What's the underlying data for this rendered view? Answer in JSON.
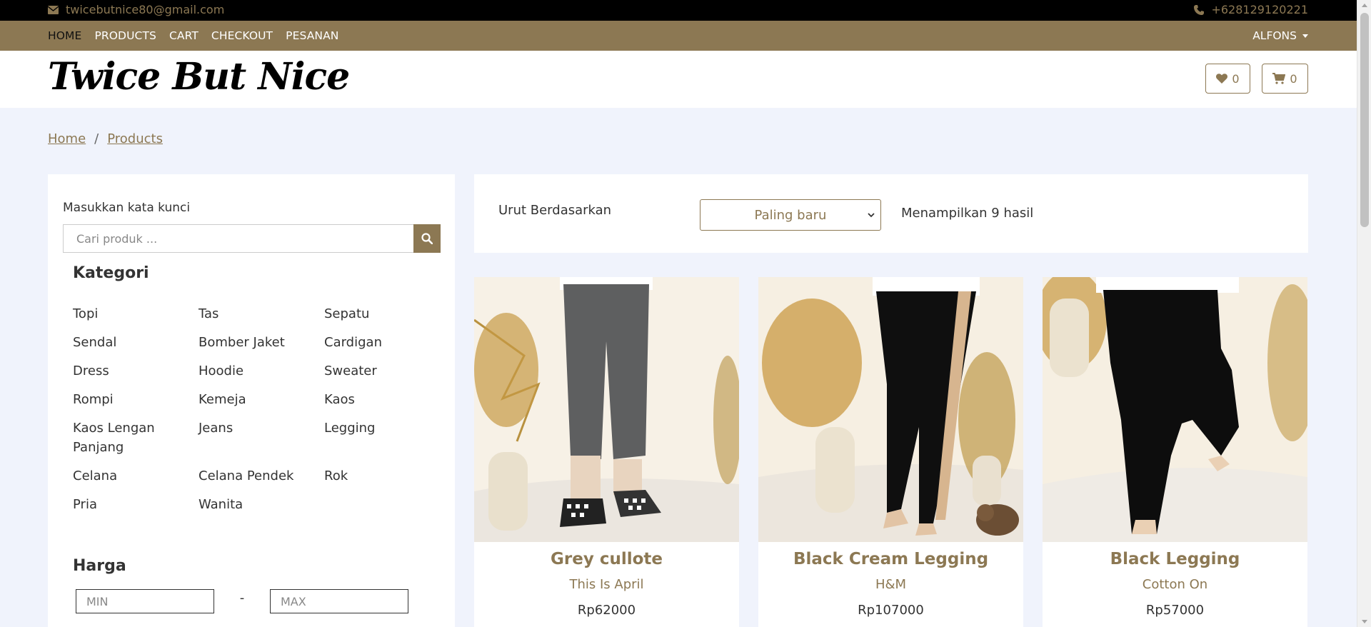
{
  "topbar": {
    "email": "twicebutnice80@gmail.com",
    "phone": "+628129120221",
    "email_icon": "envelope-icon",
    "phone_icon": "phone-icon"
  },
  "nav": {
    "items": [
      "HOME",
      "PRODUCTS",
      "CART",
      "CHECKOUT",
      "PESANAN"
    ],
    "active": "HOME",
    "user": "ALFONS"
  },
  "header": {
    "logo": "Twice But Nice",
    "wishlist_count": "0",
    "cart_count": "0",
    "wishlist_icon": "heart-icon",
    "cart_icon": "cart-icon"
  },
  "breadcrumb": {
    "home": "Home",
    "separator": "/",
    "current": "Products"
  },
  "sidebar": {
    "keyword_label": "Masukkan kata kunci",
    "search_placeholder": "Cari produk ...",
    "category_title": "Kategori",
    "categories": [
      "Topi",
      "Tas",
      "Sepatu",
      "Sendal",
      "Bomber Jaket",
      "Cardigan",
      "Dress",
      "Hoodie",
      "Sweater",
      "Rompi",
      "Kemeja",
      "Kaos",
      "Kaos Lengan Panjang",
      "Jeans",
      "Legging",
      "Celana",
      "Celana Pendek",
      "Rok",
      "Pria",
      "Wanita"
    ],
    "price_title": "Harga",
    "min_placeholder": "MIN",
    "max_placeholder": "MAX",
    "price_dash": "-"
  },
  "sort": {
    "label": "Urut Berdasarkan",
    "selected": "Paling baru",
    "result_text": "Menampilkan 9 hasil"
  },
  "products": [
    {
      "name": "Grey cullote",
      "brand": "This Is April",
      "price": "Rp62000"
    },
    {
      "name": "Black Cream Legging",
      "brand": "H&M",
      "price": "Rp107000"
    },
    {
      "name": "Black Legging",
      "brand": "Cotton On",
      "price": "Rp57000"
    }
  ],
  "colors": {
    "brand": "#8c7853",
    "topbar": "#000000",
    "page_bg": "#f0f3fc"
  }
}
